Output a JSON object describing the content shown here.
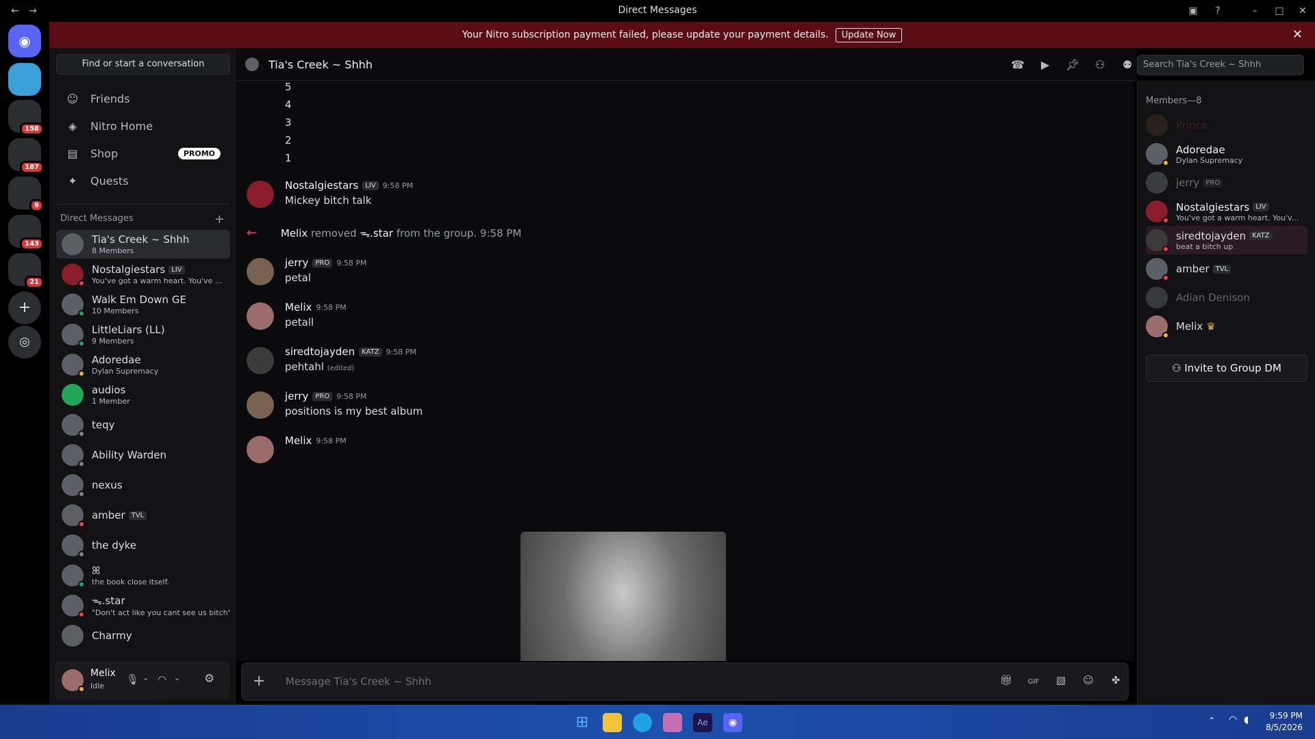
{
  "window": {
    "title": "Direct Messages"
  },
  "banner": {
    "text": "Your Nitro subscription payment failed, please update your payment details.",
    "button": "Update Now"
  },
  "guild_badges": [
    "158",
    "187",
    "9",
    "143",
    "21"
  ],
  "dm_panel": {
    "find": "Find or start a conversation",
    "nav": [
      {
        "label": "Friends"
      },
      {
        "label": "Nitro Home"
      },
      {
        "label": "Shop",
        "badge": "PROMO"
      },
      {
        "label": "Quests"
      }
    ],
    "heading": "Direct Messages",
    "dms": [
      {
        "name": "Tia's Creek ~ Shhh",
        "sub": "8 Members"
      },
      {
        "name": "Nostalgiestars",
        "tag": "LIV",
        "sub": "You've got a warm heart. You've ..."
      },
      {
        "name": "Walk Em Down GE",
        "sub": "10 Members"
      },
      {
        "name": "LittleLiars (LL)",
        "sub": "9 Members"
      },
      {
        "name": "Adoredae",
        "sub": "Dylan Supremacy"
      },
      {
        "name": "audios",
        "sub": "1 Member"
      },
      {
        "name": "teqy",
        "sub": ""
      },
      {
        "name": "Ability Warden",
        "sub": ""
      },
      {
        "name": "nexus",
        "sub": ""
      },
      {
        "name": "amber",
        "tag": "TVL",
        "sub": ""
      },
      {
        "name": "the dyke",
        "sub": ""
      },
      {
        "name": "ꕤ",
        "sub": "the book close itself."
      },
      {
        "name": "ᯓ.star",
        "sub": "\"Don't act like you cant see us bitch\""
      },
      {
        "name": "Charmy",
        "sub": ""
      }
    ]
  },
  "user": {
    "name": "Melix",
    "status": "Idle"
  },
  "chat": {
    "title": "Tia's Creek ~ Shhh",
    "search_placeholder": "Search Tia's Creek ~ Shhh",
    "countdown": [
      "5",
      "4",
      "3",
      "2",
      "1"
    ],
    "messages": [
      {
        "author": "Nostalgiestars",
        "tag": "LIV",
        "time": "9:58 PM",
        "text": "Mickey bitch talk"
      },
      {
        "system": true,
        "actor": "Melix",
        "text": "removed",
        "target": "ᯓ.star",
        "suffix": "from the group.",
        "time": "9:58 PM"
      },
      {
        "author": "jerry",
        "tag": "PRO",
        "time": "9:58 PM",
        "text": "petal"
      },
      {
        "author": "Melix",
        "time": "9:58 PM",
        "text": "petall"
      },
      {
        "author": "siredtojayden",
        "tag": "KATZ",
        "time": "9:58 PM",
        "text": "pehtahl",
        "edited": "(edited)"
      },
      {
        "author": "jerry",
        "tag": "PRO",
        "time": "9:58 PM",
        "text": "positions is my best album"
      },
      {
        "author": "Melix",
        "time": "9:58 PM",
        "text": ""
      }
    ],
    "composer_placeholder": "Message Tia's Creek ~ Shhh"
  },
  "members": {
    "heading": "Members—8",
    "list": [
      {
        "name": "Prince",
        "color": "#5e2a33"
      },
      {
        "name": "Adoredae",
        "sub": "Dylan Supremacy",
        "color": "#f2f3f5"
      },
      {
        "name": "jerry",
        "tag": "PRO",
        "color": "#6d6f78"
      },
      {
        "name": "Nostalgiestars",
        "tag": "LIV",
        "sub": "You've got a warm heart. You'v...",
        "color": "#f2f3f5"
      },
      {
        "name": "siredtojayden",
        "tag": "KATZ",
        "sub": "beat a bitch up",
        "color": "#dbdee1"
      },
      {
        "name": "amber",
        "tag": "TVL",
        "color": "#dbdee1"
      },
      {
        "name": "Adian Denison",
        "color": "#6d6f78"
      },
      {
        "name": "Melix",
        "color": "#dbdee1"
      }
    ],
    "invite": "Invite to Group DM"
  },
  "taskbar": {
    "time": "9:59 PM",
    "date": "8/5/2026"
  }
}
